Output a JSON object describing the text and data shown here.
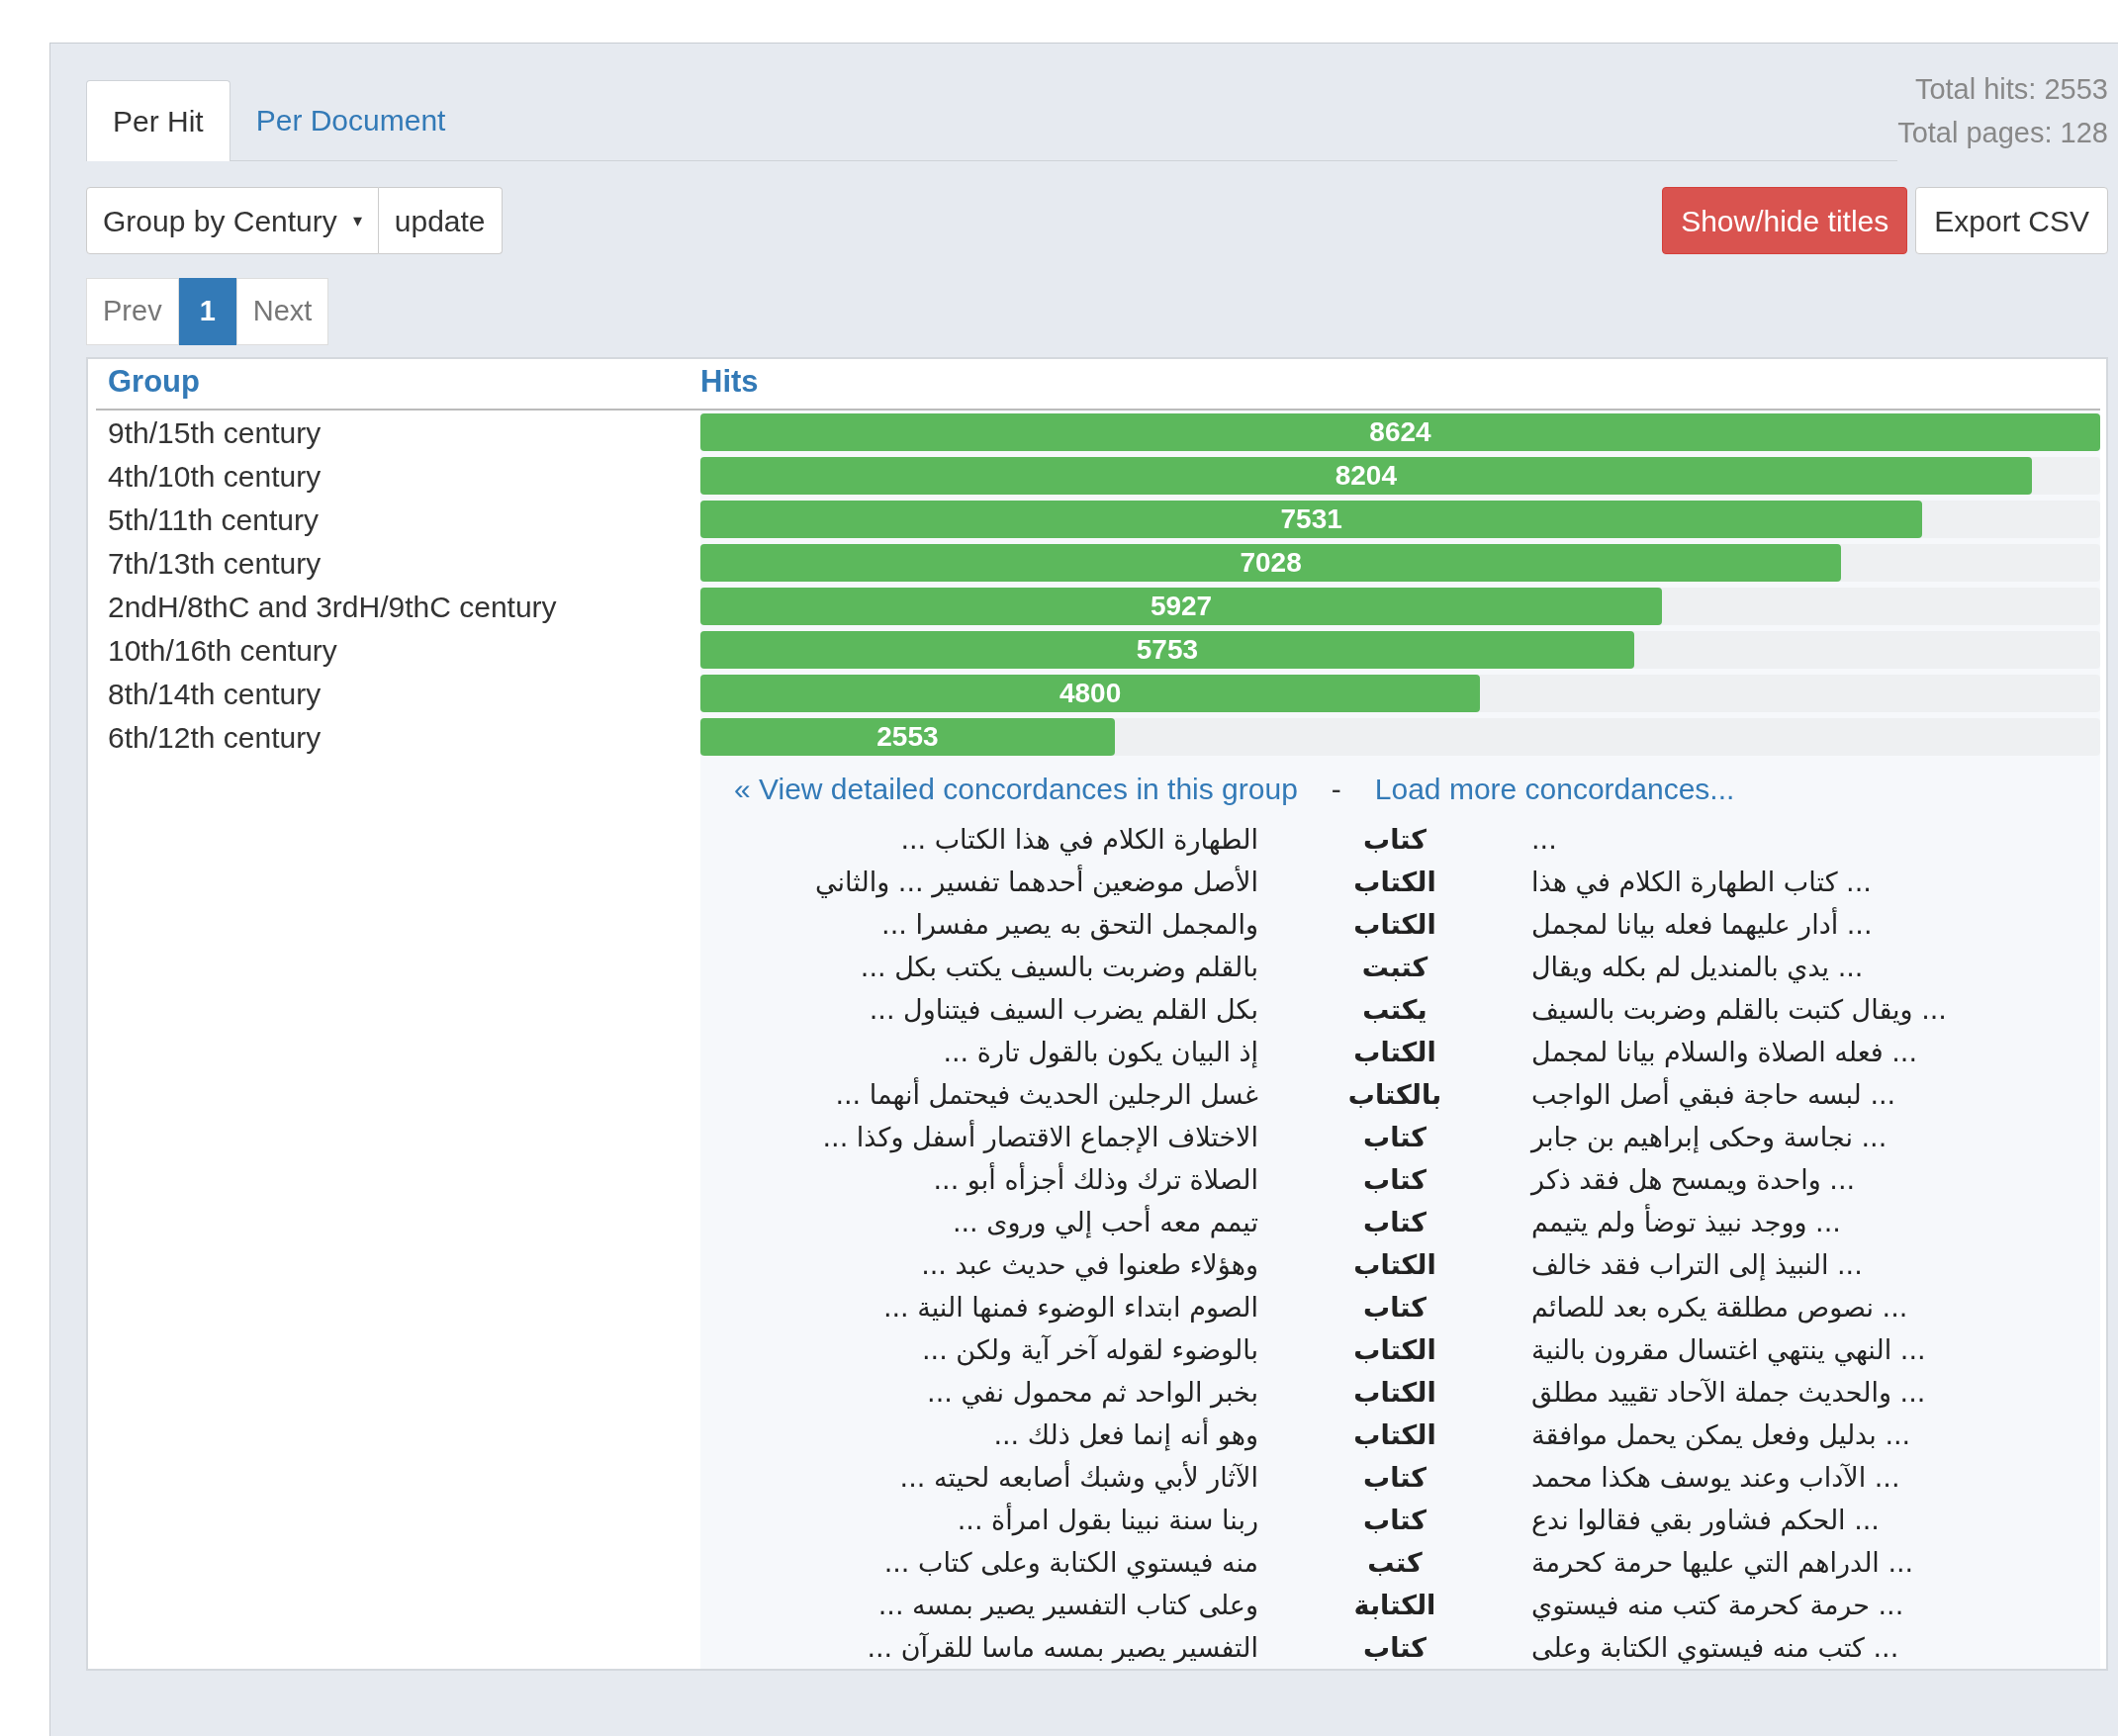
{
  "tabs": {
    "per_hit": {
      "label": "Per Hit",
      "selected": true
    },
    "per_document": {
      "label": "Per Document",
      "selected": false
    }
  },
  "totals": [
    "Total hits: 2553",
    "Total pages: 128"
  ],
  "group_by": {
    "value": "Group by Century",
    "caret": "▾"
  },
  "update_button": "update",
  "show_hide_button": "Show/hide titles",
  "export_button": "Export CSV",
  "pagination": {
    "prev": {
      "label": "Prev",
      "selected": false
    },
    "page": {
      "label": "1",
      "selected": true
    },
    "next": {
      "label": "Next",
      "selected": false
    }
  },
  "table": {
    "group_header": "Group",
    "hits_header": "Hits",
    "rows": [
      {
        "group": "9th/15th century",
        "hits": "8624",
        "level": 1.0
      },
      {
        "group": "4th/10th century",
        "hits": "8204",
        "level": 0.951
      },
      {
        "group": "5th/11th century",
        "hits": "7531",
        "level": 0.873
      },
      {
        "group": "7th/13th century",
        "hits": "7028",
        "level": 0.815
      },
      {
        "group": "2ndH/8thC and 3rdH/9thC century",
        "hits": "5927",
        "level": 0.687
      },
      {
        "group": "10th/16th century",
        "hits": "5753",
        "level": 0.667
      },
      {
        "group": "8th/14th century",
        "hits": "4800",
        "level": 0.557
      },
      {
        "group": "6th/12th century",
        "hits": "2553",
        "level": 0.296
      }
    ]
  },
  "concordance_links": {
    "view_detailed": "« View detailed concordances in this group",
    "separator": "-",
    "load_more": "Load more concordances..."
  },
  "concordances": [
    {
      "after": "الطهارة الكلام في هذا الكتاب ...",
      "keyword": "كتاب",
      "before": "..."
    },
    {
      "after": "الأصل موضعين أحدهما تفسير ... والثاني",
      "keyword": "الكتاب",
      "before": "... كتاب الطهارة الكلام في هذا"
    },
    {
      "after": "والمجمل التحق به يصير مفسرا ...",
      "keyword": "الكتاب",
      "before": "... أدار عليهما فعله بيانا لمجمل"
    },
    {
      "after": "بالقلم وضربت بالسيف يكتب بكل ...",
      "keyword": "كتبت",
      "before": "... يدي بالمنديل لم بكله ويقال"
    },
    {
      "after": "بكل القلم يضرب السيف فيتناول ...",
      "keyword": "يكتب",
      "before": "... ويقال كتبت بالقلم وضربت بالسيف"
    },
    {
      "after": "إذ البيان يكون بالقول تارة ...",
      "keyword": "الكتاب",
      "before": "... فعله الصلاة والسلام بيانا لمجمل"
    },
    {
      "after": "غسل الرجلين الحديث فيحتمل أنهما ...",
      "keyword": "بالكتاب",
      "before": "... لبسه حاجة فبقي أصل الواجب"
    },
    {
      "after": "الاختلاف الإجماع الاقتصار أسفل وكذا ...",
      "keyword": "كتاب",
      "before": "... نجاسة وحكى إبراهيم بن جابر"
    },
    {
      "after": "الصلاة ترك وذلك أجزأه أبو ...",
      "keyword": "كتاب",
      "before": "... واحدة ويمسح هل فقد ذكر"
    },
    {
      "after": "تيمم معه أحب إلي وروى ...",
      "keyword": "كتاب",
      "before": "... ووجد نبيذ توضأ ولم يتيمم"
    },
    {
      "after": "وهؤلاء طعنوا في حديث عبد ...",
      "keyword": "الكتاب",
      "before": "... النبيذ إلى التراب فقد خالف"
    },
    {
      "after": "الصوم ابتداء الوضوء فمنها النية ...",
      "keyword": "كتاب",
      "before": "... نصوص مطلقة يكره بعد للصائم"
    },
    {
      "after": "بالوضوء لقوله آخر آية ولكن ...",
      "keyword": "الكتاب",
      "before": "... النهي ينتهي اغتسال مقرون بالنية"
    },
    {
      "after": "بخبر الواحد ثم محمول نفي ...",
      "keyword": "الكتاب",
      "before": "... والحديث جملة الآحاد تقييد مطلق"
    },
    {
      "after": "وهو أنه إنما فعل ذلك ...",
      "keyword": "الكتاب",
      "before": "... بدليل وفعل يمكن يحمل موافقة"
    },
    {
      "after": "الآثار لأبي وشبك أصابعه لحيته ...",
      "keyword": "كتاب",
      "before": "... الآداب وعند يوسف هكذا محمد"
    },
    {
      "after": "ربنا سنة نبينا بقول امرأة ...",
      "keyword": "كتاب",
      "before": "... الحكم فشاور بقي فقالوا ندع"
    },
    {
      "after": "منه فيستوي الكتابة وعلى كتاب ...",
      "keyword": "كتب",
      "before": "... الدراهم التي عليها حرمة كحرمة"
    },
    {
      "after": "وعلى كتاب التفسير يصير بمسه ...",
      "keyword": "الكتابة",
      "before": "... حرمة كحرمة كتب منه فيستوي"
    },
    {
      "after": "التفسير يصير بمسه ماسا للقرآن ...",
      "keyword": "كتاب",
      "before": "... كتب منه فيستوي الكتابة وعلى"
    }
  ]
}
